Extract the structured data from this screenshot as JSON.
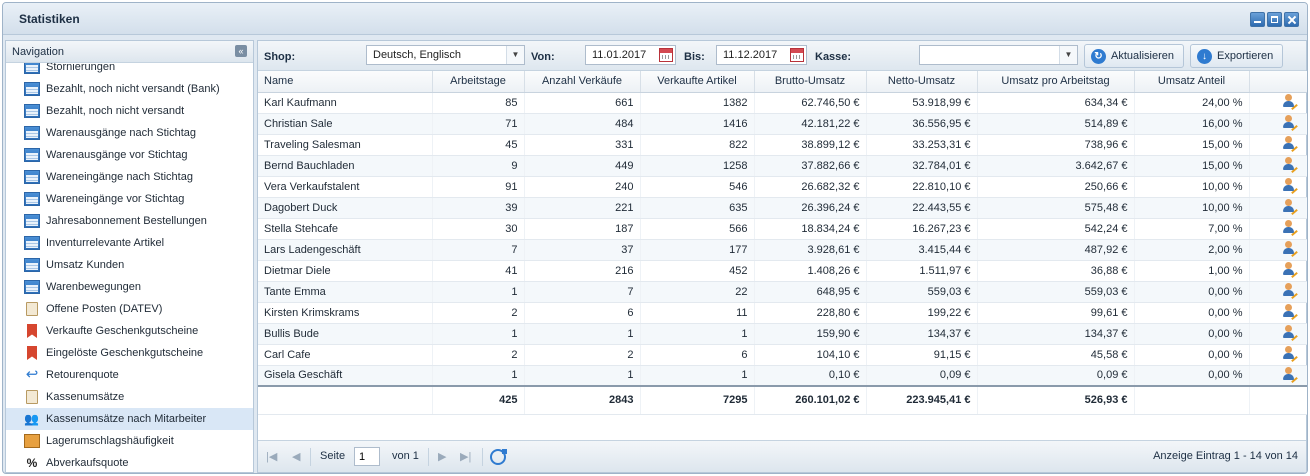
{
  "window": {
    "title": "Statistiken"
  },
  "navigation": {
    "header": "Navigation",
    "items": [
      {
        "label": "Stornierungen",
        "icon": "table-icon"
      },
      {
        "label": "Bezahlt, noch nicht versandt (Bank)",
        "icon": "table-icon"
      },
      {
        "label": "Bezahlt, noch nicht versandt",
        "icon": "table-icon"
      },
      {
        "label": "Warenausgänge nach Stichtag",
        "icon": "table-icon"
      },
      {
        "label": "Warenausgänge vor Stichtag",
        "icon": "table-icon"
      },
      {
        "label": "Wareneingänge nach Stichtag",
        "icon": "table-icon"
      },
      {
        "label": "Wareneingänge vor Stichtag",
        "icon": "table-icon"
      },
      {
        "label": "Jahresabonnement Bestellungen",
        "icon": "table-icon"
      },
      {
        "label": "Inventurrelevante Artikel",
        "icon": "table-icon"
      },
      {
        "label": "Umsatz Kunden",
        "icon": "table-icon"
      },
      {
        "label": "Warenbewegungen",
        "icon": "table-icon"
      },
      {
        "label": "Offene Posten (DATEV)",
        "icon": "document-icon"
      },
      {
        "label": "Verkaufte Geschenkgutscheine",
        "icon": "ribbon-icon"
      },
      {
        "label": "Eingelöste Geschenkgutscheine",
        "icon": "ribbon-icon"
      },
      {
        "label": "Retourenquote",
        "icon": "return-icon"
      },
      {
        "label": "Kassenumsätze",
        "icon": "document-icon"
      },
      {
        "label": "Kassenumsätze nach Mitarbeiter",
        "icon": "people-icon"
      },
      {
        "label": "Lagerumschlagshäufigkeit",
        "icon": "box-icon"
      },
      {
        "label": "Abverkaufsquote",
        "icon": "percent-icon"
      }
    ],
    "selected_index": 16
  },
  "toolbar": {
    "shop_label": "Shop:",
    "shop_value": "Deutsch, Englisch",
    "von_label": "Von:",
    "von_value": "11.01.2017",
    "bis_label": "Bis:",
    "bis_value": "11.12.2017",
    "kasse_label": "Kasse:",
    "kasse_value": "",
    "refresh_label": "Aktualisieren",
    "export_label": "Exportieren"
  },
  "grid": {
    "columns": [
      "Name",
      "Arbeitstage",
      "Anzahl Verkäufe",
      "Verkaufte Artikel",
      "Brutto-Umsatz",
      "Netto-Umsatz",
      "Umsatz pro Arbeitstag",
      "Umsatz Anteil",
      ""
    ],
    "rows": [
      [
        "Karl Kaufmann",
        "85",
        "661",
        "1382",
        "62.746,50 €",
        "53.918,99 €",
        "634,34 €",
        "24,00 %"
      ],
      [
        "Christian Sale",
        "71",
        "484",
        "1416",
        "42.181,22 €",
        "36.556,95 €",
        "514,89 €",
        "16,00 %"
      ],
      [
        "Traveling Salesman",
        "45",
        "331",
        "822",
        "38.899,12 €",
        "33.253,31 €",
        "738,96 €",
        "15,00 %"
      ],
      [
        "Bernd Bauchladen",
        "9",
        "449",
        "1258",
        "37.882,66 €",
        "32.784,01 €",
        "3.642,67 €",
        "15,00 %"
      ],
      [
        "Vera Verkaufstalent",
        "91",
        "240",
        "546",
        "26.682,32 €",
        "22.810,10 €",
        "250,66 €",
        "10,00 %"
      ],
      [
        "Dagobert Duck",
        "39",
        "221",
        "635",
        "26.396,24 €",
        "22.443,55 €",
        "575,48 €",
        "10,00 %"
      ],
      [
        "Stella Stehcafe",
        "30",
        "187",
        "566",
        "18.834,24 €",
        "16.267,23 €",
        "542,24 €",
        "7,00 %"
      ],
      [
        "Lars Ladengeschäft",
        "7",
        "37",
        "177",
        "3.928,61 €",
        "3.415,44 €",
        "487,92 €",
        "2,00 %"
      ],
      [
        "Dietmar Diele",
        "41",
        "216",
        "452",
        "1.408,26 €",
        "1.511,97 €",
        "36,88 €",
        "1,00 %"
      ],
      [
        "Tante Emma",
        "1",
        "7",
        "22",
        "648,95 €",
        "559,03 €",
        "559,03 €",
        "0,00 %"
      ],
      [
        "Kirsten Krimskrams",
        "2",
        "6",
        "11",
        "228,80 €",
        "199,22 €",
        "99,61 €",
        "0,00 %"
      ],
      [
        "Bullis Bude",
        "1",
        "1",
        "1",
        "159,90 €",
        "134,37 €",
        "134,37 €",
        "0,00 %"
      ],
      [
        "Carl Cafe",
        "2",
        "2",
        "6",
        "104,10 €",
        "91,15 €",
        "45,58 €",
        "0,00 %"
      ],
      [
        "Gisela Geschäft",
        "1",
        "1",
        "1",
        "0,10 €",
        "0,09 €",
        "0,09 €",
        "0,00 %"
      ]
    ],
    "totals": [
      "",
      "425",
      "2843",
      "7295",
      "260.101,02 €",
      "223.945,41 €",
      "526,93 €",
      ""
    ]
  },
  "pager": {
    "page_label": "Seite",
    "page_value": "1",
    "of_label": "von 1",
    "display_text": "Anzeige Eintrag 1 - 14 von 14"
  }
}
